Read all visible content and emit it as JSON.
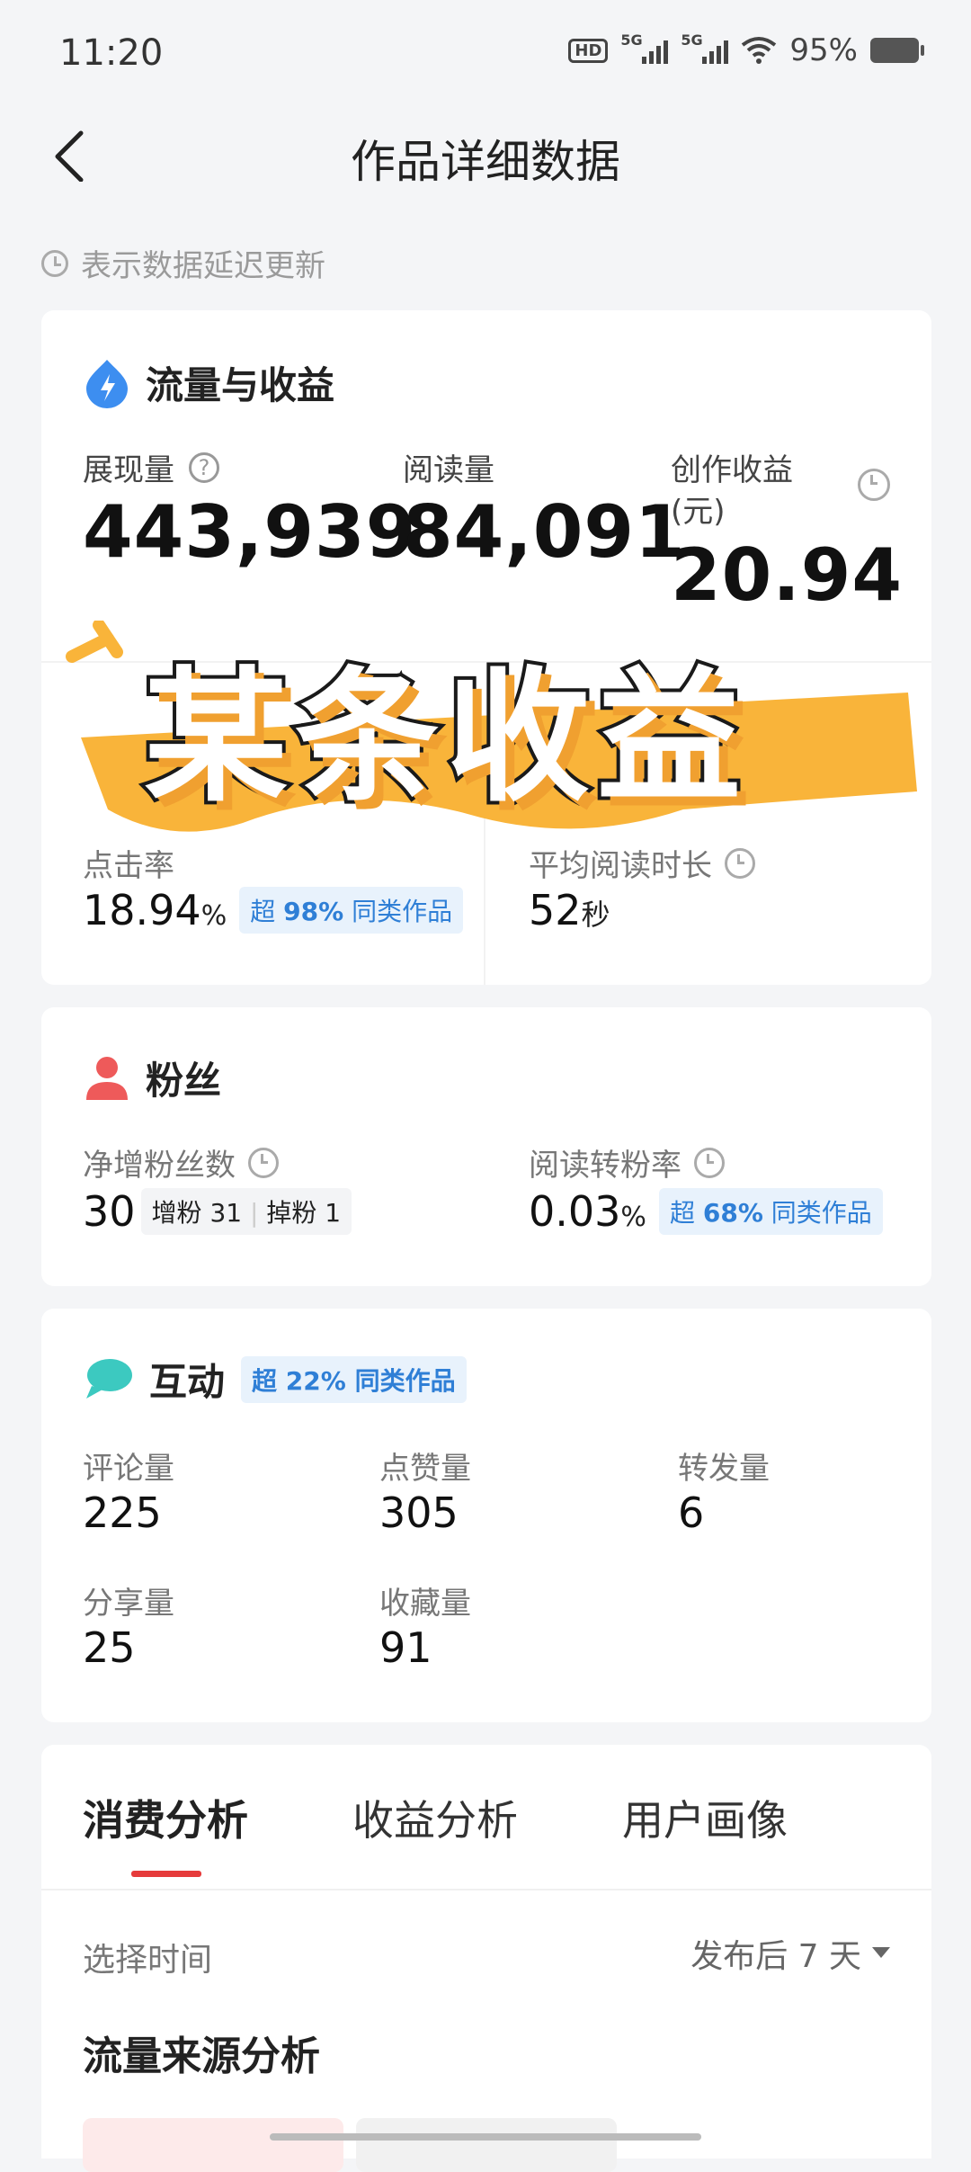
{
  "status": {
    "time": "11:20",
    "battery": "95%",
    "hd": "HD",
    "sig1": "5G",
    "sig2": "5G"
  },
  "nav": {
    "title": "作品详细数据"
  },
  "notice": "表示数据延迟更新",
  "traffic": {
    "title": "流量与收益",
    "impressions_label": "展现量",
    "impressions": "443,939",
    "reads_label": "阅读量",
    "reads": "84,091",
    "earnings_label": "创作收益",
    "earnings_unit": "(元)",
    "earnings": "20.94",
    "ctr_label": "点击率",
    "ctr": "18.94",
    "ctr_unit": "%",
    "ctr_badge_pre": "超",
    "ctr_badge_pct": "98%",
    "ctr_badge_post": "同类作品",
    "avg_read_label": "平均阅读时长",
    "avg_read": "52",
    "avg_read_unit": "秒"
  },
  "overlay": {
    "text": "某条收益"
  },
  "fans": {
    "title": "粉丝",
    "net_label": "净增粉丝数",
    "net": "30",
    "gain_label": "增粉",
    "gain": "31",
    "lose_label": "掉粉",
    "lose": "1",
    "conv_label": "阅读转粉率",
    "conv": "0.03",
    "conv_unit": "%",
    "conv_badge_pre": "超",
    "conv_badge_pct": "68%",
    "conv_badge_post": "同类作品"
  },
  "interact": {
    "title": "互动",
    "badge_pre": "超",
    "badge_pct": "22%",
    "badge_post": "同类作品",
    "comments_label": "评论量",
    "comments": "225",
    "likes_label": "点赞量",
    "likes": "305",
    "reposts_label": "转发量",
    "reposts": "6",
    "shares_label": "分享量",
    "shares": "25",
    "favs_label": "收藏量",
    "favs": "91"
  },
  "analysis": {
    "tabs": [
      "消费分析",
      "收益分析",
      "用户画像"
    ],
    "time_label": "选择时间",
    "time_value": "发布后 7 天",
    "section_title": "流量来源分析"
  }
}
